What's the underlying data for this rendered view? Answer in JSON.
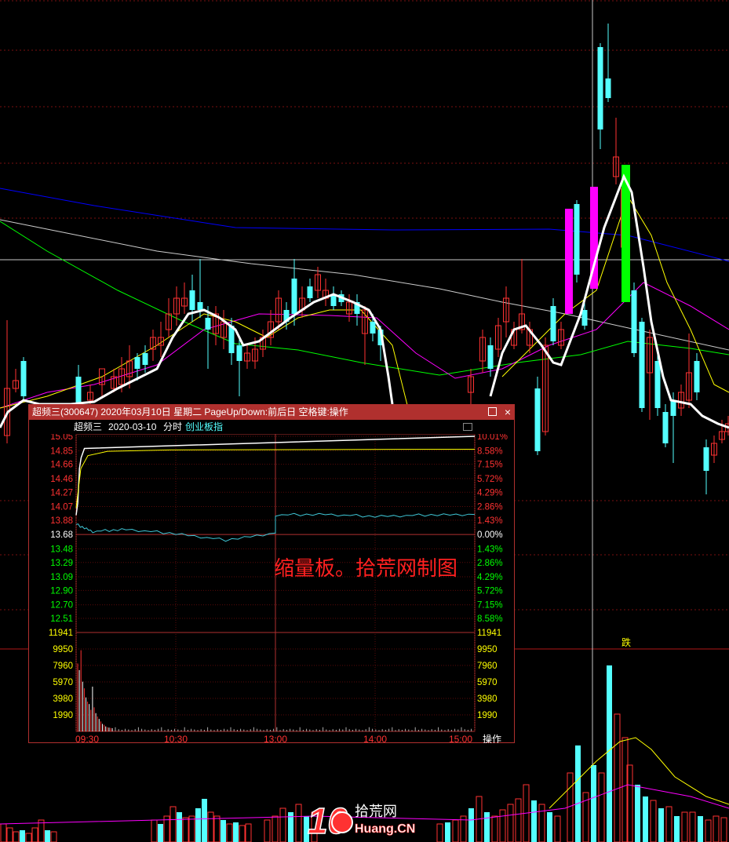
{
  "colors": {
    "up": "#ff3232",
    "down": "#54ffff",
    "limit_up": "#ff00ff",
    "limit_down": "#00ff00",
    "ma_white": "#ffffff",
    "ma_yellow": "#ffff00",
    "ma_magenta": "#ff00ff",
    "ma_green": "#00ff00",
    "ma_blue": "#0000ff",
    "ma_grey": "#cccccc",
    "dotted_grid": "#7a1010",
    "popup_border": "#b0302e"
  },
  "main": {
    "marker_label": "跌",
    "watermark": {
      "digits": "10",
      "brand_cn": "拾荒网",
      "brand_en": "Huang.CN"
    }
  },
  "popup": {
    "title": "超频三(300647) 2020年03月10日 星期二 PageUp/Down:前后日 空格键:操作",
    "header": {
      "name": "超频三",
      "date": "2020-03-10",
      "mode": "分时",
      "index": "创业板指"
    },
    "annotation": "缩量板。拾荒网制图",
    "operate_label": "操作"
  },
  "chart_data": {
    "type": "line",
    "title": "超频三 2020-03-10 分时",
    "prev_close": 13.68,
    "price_ticks": [
      15.05,
      14.85,
      14.66,
      14.46,
      14.27,
      14.07,
      13.88,
      13.68,
      13.48,
      13.29,
      13.09,
      12.9,
      12.7,
      12.51
    ],
    "pct_ticks": [
      "10.01%",
      "8.58%",
      "7.15%",
      "5.72%",
      "4.29%",
      "2.86%",
      "1.43%",
      "0.00%",
      "1.43%",
      "2.86%",
      "4.29%",
      "5.72%",
      "7.15%",
      "8.58%"
    ],
    "volume_ticks": [
      11941,
      9950,
      7960,
      5970,
      3980,
      1990
    ],
    "x_ticks": [
      "09:30",
      "10:30",
      "13:00",
      "14:00",
      "15:00"
    ],
    "series": [
      {
        "name": "超频三",
        "x": [
          "09:30",
          "09:31",
          "09:32",
          "09:33",
          "09:35",
          "15:00"
        ],
        "values": [
          13.95,
          14.12,
          14.6,
          14.75,
          14.88,
          15.05
        ]
      },
      {
        "name": "创业板指",
        "x": [
          "09:30",
          "09:40",
          "10:00",
          "10:30",
          "11:00",
          "11:30",
          "13:00",
          "13:30",
          "14:00",
          "14:30",
          "15:00"
        ],
        "values": [
          13.82,
          13.72,
          13.75,
          13.69,
          13.6,
          13.7,
          13.95,
          13.96,
          13.93,
          13.95,
          13.96
        ]
      }
    ]
  }
}
